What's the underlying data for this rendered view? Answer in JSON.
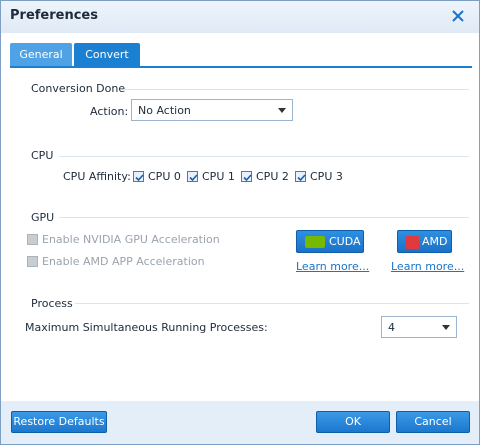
{
  "window": {
    "title": "Preferences"
  },
  "tabs": [
    {
      "label": "General",
      "active": false
    },
    {
      "label": "Convert",
      "active": true
    }
  ],
  "conversion_done": {
    "heading": "Conversion Done",
    "action_label": "Action:",
    "action_value": "No Action"
  },
  "cpu": {
    "heading": "CPU",
    "affinity_label": "CPU Affinity:",
    "cores": [
      {
        "label": "CPU 0",
        "checked": true
      },
      {
        "label": "CPU 1",
        "checked": true
      },
      {
        "label": "CPU 2",
        "checked": true
      },
      {
        "label": "CPU 3",
        "checked": true
      }
    ]
  },
  "gpu": {
    "heading": "GPU",
    "nvidia_label": "Enable NVIDIA GPU Acceleration",
    "amd_label": "Enable AMD APP Acceleration",
    "nvidia_checked": false,
    "amd_checked": false,
    "cuda_button": "CUDA",
    "amd_button": "AMD",
    "learn_more_cuda": "Learn more...",
    "learn_more_amd": "Learn more..."
  },
  "process": {
    "heading": "Process",
    "max_label": "Maximum Simultaneous Running Processes:",
    "max_value": "4"
  },
  "footer": {
    "restore_label": "Restore Defaults",
    "ok_label": "OK",
    "cancel_label": "Cancel"
  },
  "colors": {
    "accent": "#1b7fd2",
    "tab_inactive": "#4ea2e5",
    "nvidia": "#76b900",
    "amd": "#e0393e"
  }
}
